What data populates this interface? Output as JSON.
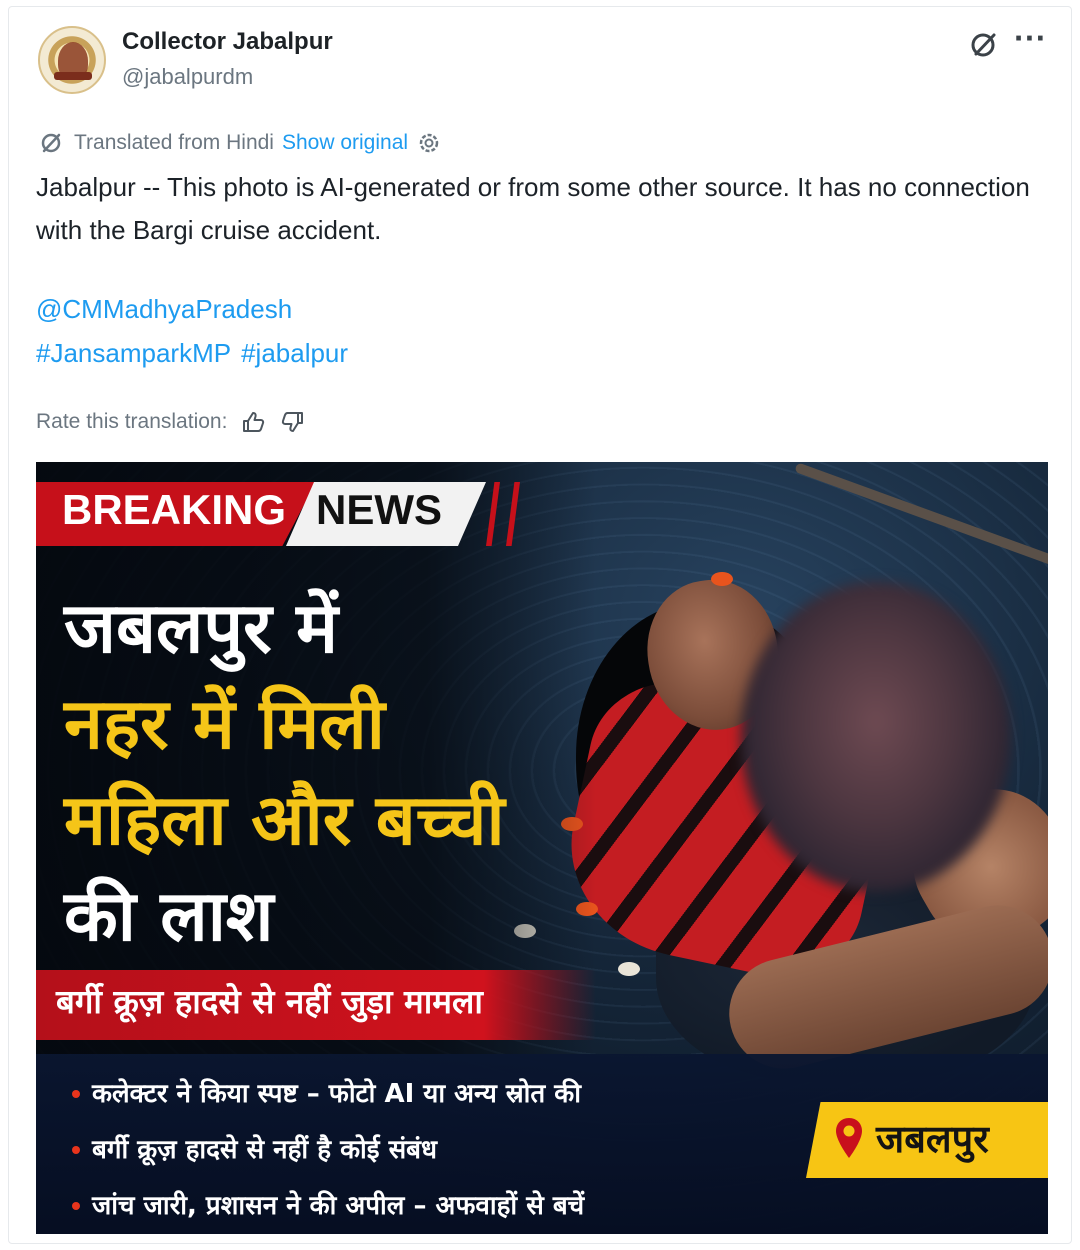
{
  "tweet": {
    "display_name": "Collector Jabalpur",
    "handle": "@jabalpurdm",
    "translation": {
      "notice": "Translated from Hindi",
      "show_original": "Show original"
    },
    "text": "Jabalpur -- This photo is AI-generated or from some other source. It has no connection with the Bargi cruise accident.",
    "mention": "@CMMadhyaPradesh",
    "hashtags": [
      "#JansamparkMP",
      "#jabalpur"
    ],
    "rate_label": "Rate this translation:"
  },
  "media": {
    "breaking": "BREAKING",
    "news": "NEWS",
    "headline_lines": [
      "जबलपुर में",
      "नहर में मिली",
      "महिला और बच्ची",
      "की लाश"
    ],
    "subheadline": "बर्गी क्रूज़ हादसे से नहीं जुड़ा मामला",
    "bullets": [
      "कलेक्टर ने किया स्पष्ट – फोटो AI या अन्य स्रोत की",
      "बर्गी क्रूज़ हादसे से नहीं है कोई संबंध",
      "जांच जारी, प्रशासन ने की अपील – अफवाहों से बचें"
    ],
    "location": "जबलपुर"
  },
  "icons": {
    "grok": "grok-icon",
    "more": "more-icon",
    "translate": "translate-icon",
    "settings": "gear-icon",
    "thumbs_up": "thumbs-up-icon",
    "thumbs_down": "thumbs-down-icon",
    "location": "location-pin-icon"
  },
  "colors": {
    "link": "#1d9bf0",
    "breaking_red": "#c6101a",
    "headline_yellow": "#f5c518",
    "location_yellow": "#f7c514"
  }
}
